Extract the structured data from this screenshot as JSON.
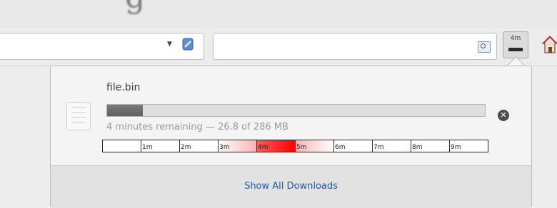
{
  "window": {
    "title_fragment": "g"
  },
  "toolbar": {
    "downloads_button": {
      "time_label": "4m",
      "progress": 1.0
    },
    "icons": [
      "dropdown-arrow-icon",
      "feed-icon",
      "search-icon",
      "downloads-icon",
      "home-icon"
    ]
  },
  "download": {
    "file_name": "file.bin",
    "progress_fraction": 0.094,
    "status": "4 minutes remaining — 26.8 of 286 MB"
  },
  "timeline": {
    "ticks": [
      "",
      "1m",
      "2m",
      "3m",
      "4m",
      "5m",
      "6m",
      "7m",
      "8m",
      "9m"
    ],
    "highlight_tick": "4m",
    "highlight_color": "#ff0000"
  },
  "footer": {
    "show_all_label": "Show All Downloads"
  },
  "colors": {
    "link": "#1f5aa6",
    "panel_bg": "#f4f4f4",
    "footer_bg": "#e2e2e2"
  }
}
